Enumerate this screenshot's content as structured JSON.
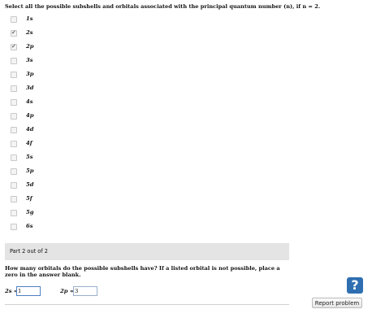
{
  "part1": {
    "question": "Select all the possible subshells and orbitals associated with the principal quantum number (n), if n = 2.",
    "options": [
      {
        "label": "1s",
        "checked": false
      },
      {
        "label": "2s",
        "checked": true
      },
      {
        "label": "2p",
        "checked": true
      },
      {
        "label": "3s",
        "checked": false
      },
      {
        "label": "3p",
        "checked": false
      },
      {
        "label": "3d",
        "checked": false
      },
      {
        "label": "4s",
        "checked": false
      },
      {
        "label": "4p",
        "checked": false
      },
      {
        "label": "4d",
        "checked": false
      },
      {
        "label": "4f",
        "checked": false
      },
      {
        "label": "5s",
        "checked": false
      },
      {
        "label": "5p",
        "checked": false
      },
      {
        "label": "5d",
        "checked": false
      },
      {
        "label": "5f",
        "checked": false
      },
      {
        "label": "5g",
        "checked": false
      },
      {
        "label": "6s",
        "checked": false
      }
    ]
  },
  "part2": {
    "header": "Part 2 out of 2",
    "question": "How many orbitals do the possible subshells have? If a listed orbital is not possible, place a zero in the answer blank.",
    "answers": [
      {
        "label": "2s =",
        "value": "1"
      },
      {
        "label": "2p =",
        "value": "3"
      }
    ]
  },
  "help_label": "?",
  "report_label": "Report problem",
  "colors": {
    "help_button": "#2f6fb1",
    "part_bar": "#e4e4e4",
    "input_border": "#4f7fc2"
  }
}
